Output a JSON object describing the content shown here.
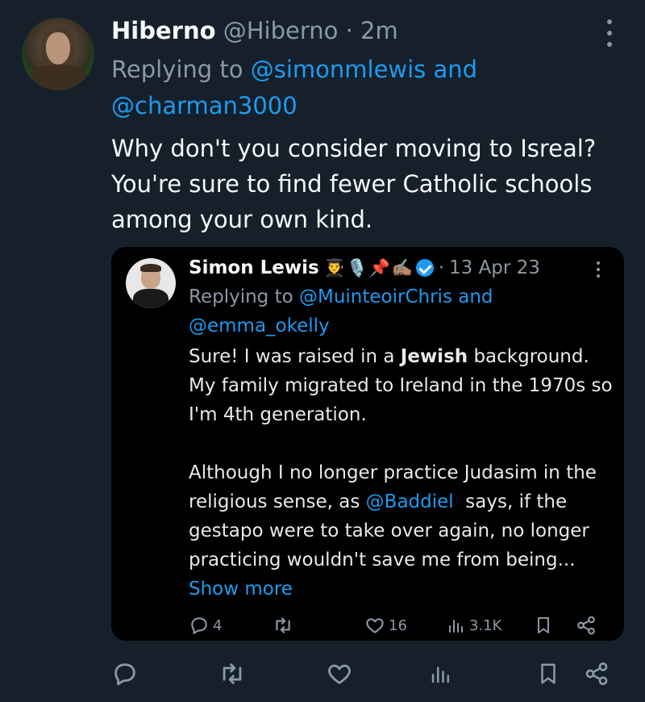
{
  "tweet": {
    "author_name": "Hiberno",
    "author_handle": "@Hiberno",
    "separator": "·",
    "time": "2m",
    "replying_prefix": "Replying to ",
    "replying_user_1": "@simonmlewis and",
    "replying_user_2": "@charman3000",
    "body_lines": [
      "Why don't you consider moving to Isreal?",
      "You're sure to find fewer Catholic schools",
      "among your own kind."
    ]
  },
  "quoted": {
    "author_name": "Simon Lewis",
    "emojis": [
      "👨‍🎓",
      "🎙️",
      "📌",
      "✍🏽"
    ],
    "separator": "·",
    "date": "13 Apr 23",
    "replying_prefix": "Replying to ",
    "replying_user_1": "@MuinteoirChris and",
    "replying_user_2": "@emma_okelly",
    "para1_pre": "Sure! I was raised in a ",
    "para1_bold": "Jewish",
    "para1_post": " background. My family migrated to Ireland in the 1970s so I'm 4th generation.",
    "para2_pre": "Although I no longer practice Judasim in the religious sense, as ",
    "para2_mention": "@Baddiel",
    "para2_post": "  says, if the gestapo were to take over again, no longer practicing wouldn't save me from being... ",
    "show_more": "Show more",
    "stats": {
      "replies": "4",
      "likes": "16",
      "views": "3.1K"
    }
  },
  "icons": {
    "reply": "reply-icon",
    "retweet": "retweet-icon",
    "like": "heart-icon",
    "views": "views-icon",
    "bookmark": "bookmark-icon",
    "share": "share-icon",
    "more": "more-icon",
    "verified": "verified-icon"
  },
  "colors": {
    "background": "#15202b",
    "quote_background": "#000000",
    "link": "#1d9bf0",
    "muted": "#8b98a5",
    "text": "#f7f9f9"
  }
}
